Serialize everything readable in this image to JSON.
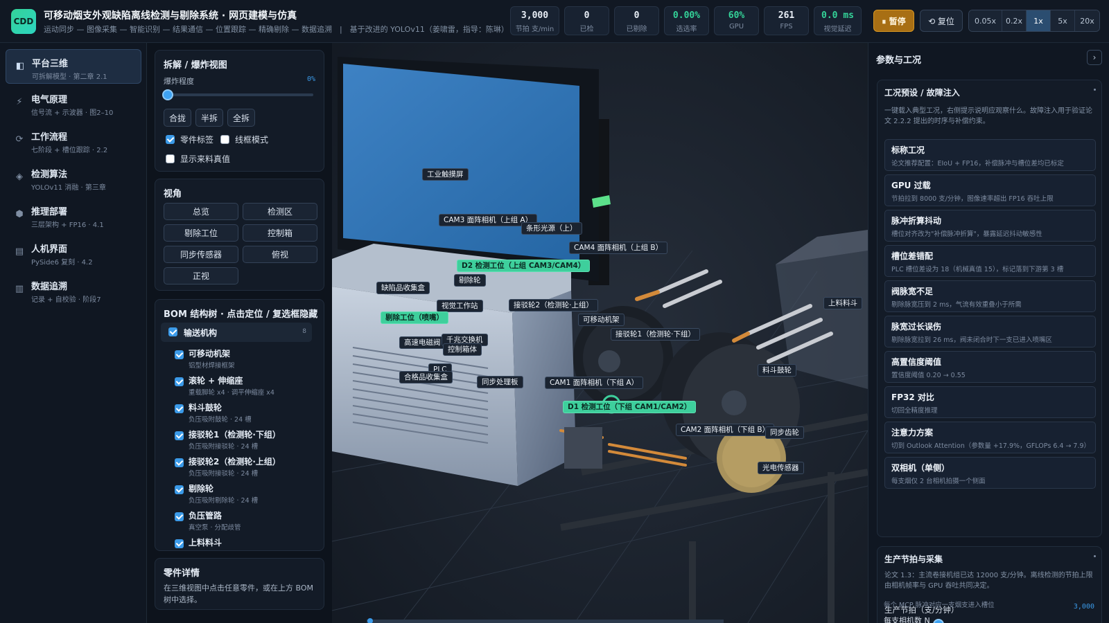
{
  "header": {
    "logo": "CDD",
    "title": "可移动烟支外观缺陷离线检测与剔除系统 · 网页建模与仿真",
    "subtitle": "运动同步 — 图像采集 — 智能识别 — 结果通信 — 位置跟踪 — 精确剔除 — 数据追溯　|　基于改进的 YOLOv11（姜啸雷，指导：陈琳）",
    "stats": [
      {
        "value": "3,000",
        "label": "节拍 支/min"
      },
      {
        "value": "0",
        "label": "已检"
      },
      {
        "value": "0",
        "label": "已剔除"
      },
      {
        "value": "0.00%",
        "label": "选选率"
      },
      {
        "value": "60%",
        "label": "GPU"
      },
      {
        "value": "261",
        "label": "FPS"
      },
      {
        "value": "0.0 ms",
        "label": "视觉延迟"
      }
    ],
    "pause_label": "⏸ 暂停",
    "reset_label": "⟲ 复位",
    "speeds": [
      "0.05x",
      "0.2x",
      "1x",
      "5x",
      "20x"
    ],
    "active_speed": "1x"
  },
  "nav": [
    {
      "title": "平台三维",
      "sub": "可拆解模型 · 第二章 2.1",
      "icon": "◧"
    },
    {
      "title": "电气原理",
      "sub": "信号流 + 示波器 · 图2–10",
      "icon": "⚡"
    },
    {
      "title": "工作流程",
      "sub": "七阶段 + 槽位跟踪 · 2.2",
      "icon": "⟳"
    },
    {
      "title": "检测算法",
      "sub": "YOLOv11 消融 · 第三章",
      "icon": "◈"
    },
    {
      "title": "推理部署",
      "sub": "三层架构 + FP16 · 4.1",
      "icon": "⬢"
    },
    {
      "title": "人机界面",
      "sub": "PySide6 复刻 · 4.2",
      "icon": "▤"
    },
    {
      "title": "数据追溯",
      "sub": "记录 + 自校验 · 阶段7",
      "icon": "▥"
    }
  ],
  "explode": {
    "title": "拆解 / 爆炸视图",
    "label": "爆炸程度",
    "value": "0%",
    "level": 0,
    "buttons": [
      "合拢",
      "半拆",
      "全拆"
    ],
    "options": [
      {
        "label": "零件标签",
        "checked": true
      },
      {
        "label": "线框模式",
        "checked": false
      },
      {
        "label": "显示来料真值",
        "checked": false
      }
    ]
  },
  "views": {
    "title": "视角",
    "buttons": [
      "总览",
      "检测区",
      "剔除工位",
      "控制箱",
      "同步传感器",
      "俯视",
      "正视"
    ]
  },
  "bom": {
    "title": "BOM 结构树 · 点击定位 / 复选框隐藏",
    "group": "输送机构",
    "group_count": "8",
    "items": [
      {
        "name": "可移动机架",
        "desc": "铝型材焊接框架"
      },
      {
        "name": "滚轮 + 伸缩座",
        "desc": "重载脚轮 x4 · 调平伸缩座 x4"
      },
      {
        "name": "料斗鼓轮",
        "desc": "负压吸附鼓轮 · 24 槽"
      },
      {
        "name": "接驳轮1（检测轮·下组）",
        "desc": "负压吸附接驳轮 · 24 槽"
      },
      {
        "name": "接驳轮2（检测轮·上组）",
        "desc": "负压吸附接驳轮 · 24 槽"
      },
      {
        "name": "剔除轮",
        "desc": "负压吸附剔除轮 · 24 槽"
      },
      {
        "name": "负压管路",
        "desc": "真空泵 · 分配歧管"
      },
      {
        "name": "上料料斗",
        "desc": ""
      }
    ]
  },
  "part_detail": {
    "title": "零件详情",
    "text": "在三维视图中点击任意零件，或在上方 BOM 树中选择。"
  },
  "viewport_labels": [
    {
      "text": "工业触摸屏",
      "hl": false
    },
    {
      "text": "CAM3 面阵相机（上组 A）",
      "hl": false
    },
    {
      "text": "条形光源（上）",
      "hl": false
    },
    {
      "text": "CAM4 面阵相机（上组 B）",
      "hl": false
    },
    {
      "text": "D2 检测工位（上组 CAM3/CAM4）",
      "hl": true
    },
    {
      "text": "剔除轮",
      "hl": false
    },
    {
      "text": "缺陷品收集盒",
      "hl": false
    },
    {
      "text": "视觉工作站",
      "hl": false
    },
    {
      "text": "接驳轮2（检测轮·上组）",
      "hl": false
    },
    {
      "text": "剔除工位（喷嘴）",
      "hl": true
    },
    {
      "text": "可移动机架",
      "hl": false
    },
    {
      "text": "上料料斗",
      "hl": false
    },
    {
      "text": "接驳轮1（检测轮·下组）",
      "hl": false
    },
    {
      "text": "高速电磁阀",
      "hl": false
    },
    {
      "text": "千兆交换机",
      "hl": false
    },
    {
      "text": "控制箱体",
      "hl": false
    },
    {
      "text": "PLC",
      "hl": false
    },
    {
      "text": "合格品收集盒",
      "hl": false
    },
    {
      "text": "同步处理板",
      "hl": false
    },
    {
      "text": "CAM1 面阵相机（下组 A）",
      "hl": false
    },
    {
      "text": "料斗鼓轮",
      "hl": false
    },
    {
      "text": "D1 检测工位（下组 CAM1/CAM2）",
      "hl": true
    },
    {
      "text": "CAM2 面阵相机（下组 B）",
      "hl": false
    },
    {
      "text": "同步齿轮",
      "hl": false
    },
    {
      "text": "光电传感器",
      "hl": false
    }
  ],
  "right": {
    "title": "参数与工况",
    "collapse_icon": "›",
    "presets": {
      "title": "工况预设 / 故障注入",
      "note": "一键载入典型工况，右侧提示说明应观察什么。故障注入用于验证论文 2.2.2 提出的时序与补偿约束。",
      "items": [
        {
          "title": "标称工况",
          "desc": "论文推荐配置：EIoU + FP16，补偿脉冲与槽位差均已标定"
        },
        {
          "title": "GPU 过载",
          "desc": "节拍拉到 8000 支/分钟，图像速率超出 FP16 吞吐上限"
        },
        {
          "title": "脉冲折算抖动",
          "desc": "槽位对齐改为\"补偿脉冲折算\"，暴露延迟抖动敏感性"
        },
        {
          "title": "槽位差错配",
          "desc": "PLC 槽位差设为 18（机械真值 15），标记落到下游第 3 槽"
        },
        {
          "title": "阀脉宽不足",
          "desc": "剔除脉宽压到 2 ms，气流有效重叠小于所需"
        },
        {
          "title": "脉宽过长误伤",
          "desc": "剔除脉宽拉到 26 ms，阀未闭合时下一支已进入喷嘴区"
        },
        {
          "title": "高置信度阈值",
          "desc": "置信度阈值 0.20 → 0.55"
        },
        {
          "title": "FP32 对比",
          "desc": "切回全精度推理"
        },
        {
          "title": "注意力方案",
          "desc": "切到 Outlook Attention（参数量 +17.9%，GFLOPs 6.4 → 7.9）"
        },
        {
          "title": "双相机（单侧）",
          "desc": "每支烟仅 2 台相机拍摄一个侧面"
        }
      ]
    },
    "production": {
      "title": "生产节拍与采集",
      "note": "论文 1.3：主流卷接机组已达 12000 支/分钟。离线检测的节拍上限由相机帧率与 GPU 吞吐共同决定。",
      "rate_label": "生产节拍（支/分钟）",
      "rate_value": "3,000",
      "rate_level": 0.25,
      "rate_hint": "每个 MCP 脉冲对应一支烟支进入槽位",
      "next_label": "每支相机数 N"
    }
  }
}
